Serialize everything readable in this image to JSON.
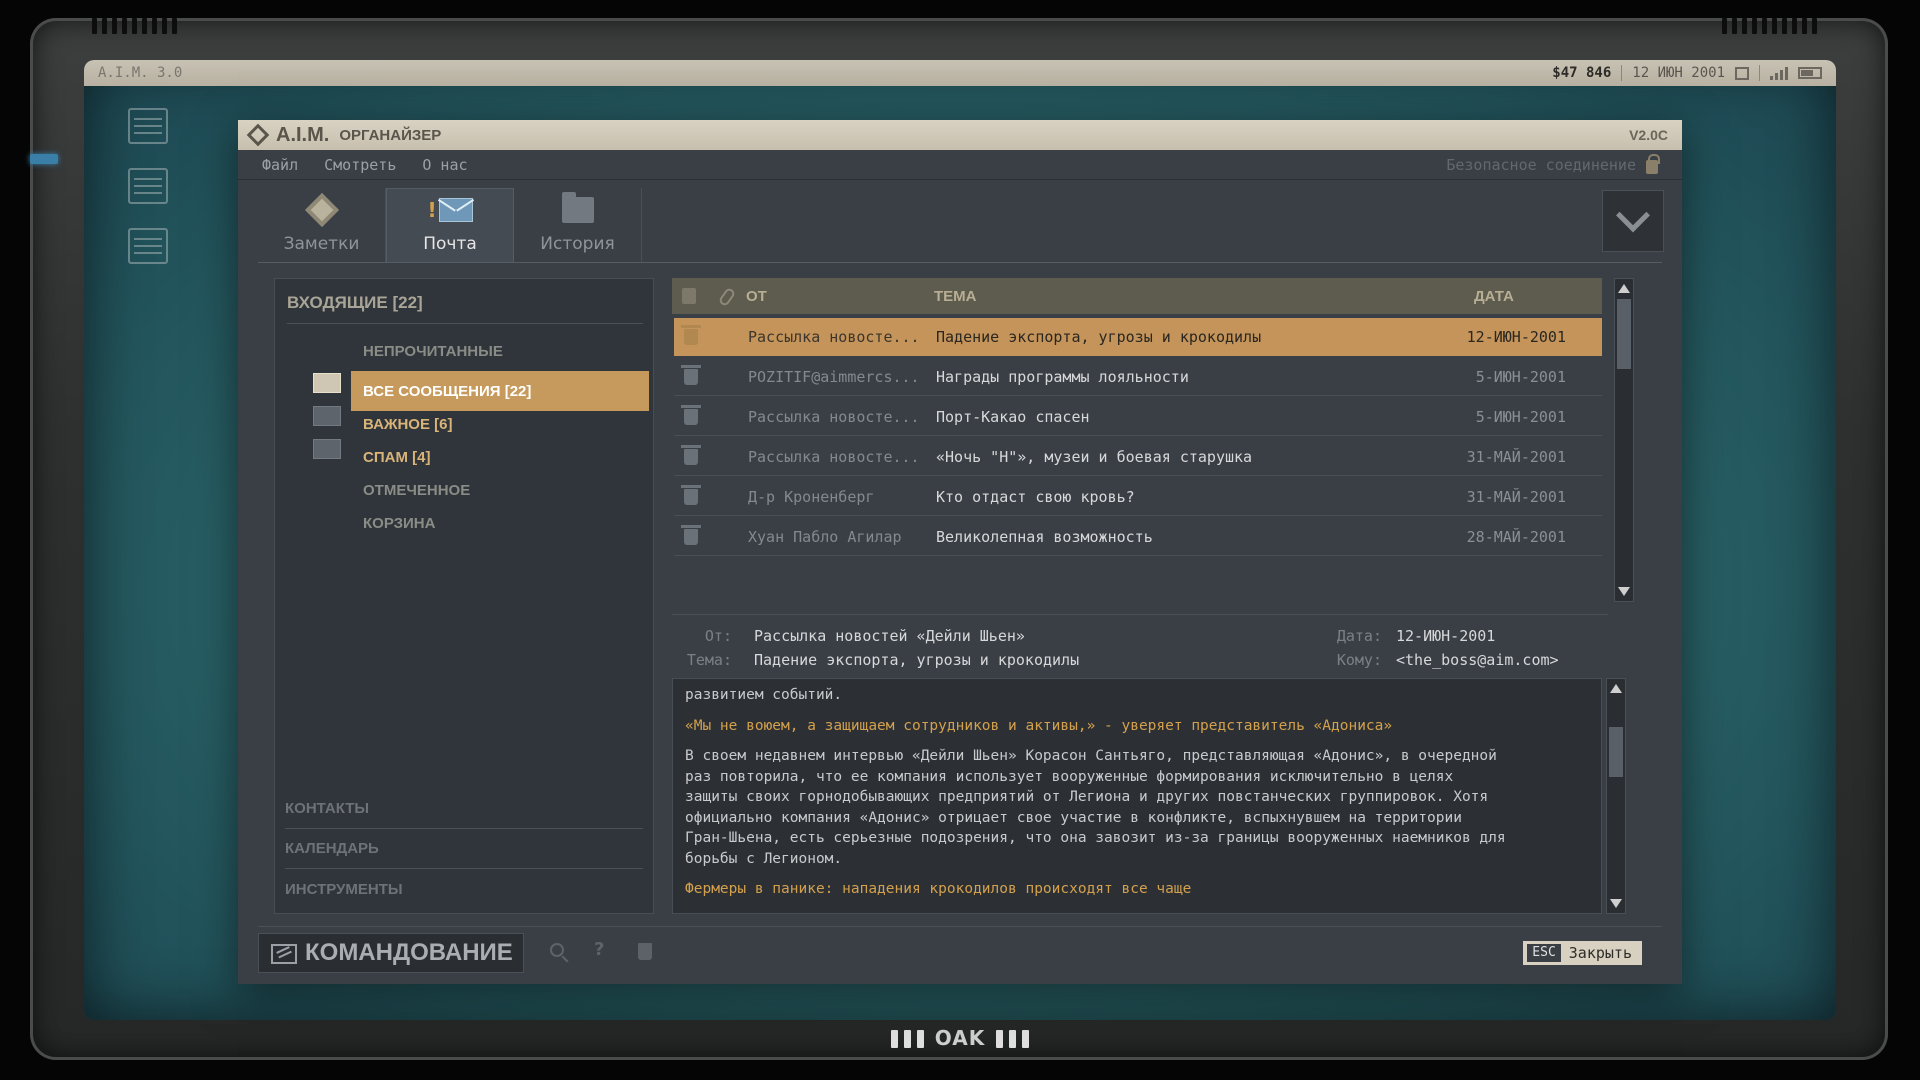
{
  "os": {
    "title": "A.I.M. 3.0",
    "balance": "$47 846",
    "date": "12 ИЮН 2001"
  },
  "window": {
    "title": "A.I.M.",
    "subtitle": "ОРГАНАЙЗЕР",
    "version": "V2.0C",
    "menu": [
      "Файл",
      "Смотреть",
      "О нас"
    ],
    "secure_text": "Безопасное соединение"
  },
  "tabs": [
    {
      "label": "Заметки",
      "icon": "diamond-icon"
    },
    {
      "label": "Почта",
      "icon": "mail-icon",
      "active": true,
      "badge": "!"
    },
    {
      "label": "История",
      "icon": "folder-icon"
    }
  ],
  "folders": {
    "inbox_title": "ВХОДЯЩИЕ [22]",
    "items": [
      {
        "label": "НЕПРОЧИТАННЫЕ"
      },
      {
        "label": "ВСЕ СООБЩЕНИЯ [22]",
        "active": true
      },
      {
        "label": "ВАЖНОЕ [6]"
      },
      {
        "label": "СПАМ [4]"
      },
      {
        "label": "ОТМЕЧЕННОЕ"
      },
      {
        "label": "КОРЗИНА"
      }
    ],
    "sections": [
      "КОНТАКТЫ",
      "КАЛЕНДАРЬ",
      "ИНСТРУМЕНТЫ"
    ]
  },
  "list": {
    "headers": {
      "from": "ОТ",
      "subject": "ТЕМА",
      "date": "ДАТА"
    },
    "rows": [
      {
        "from": "Рассылка новосте...",
        "subject": "Падение экспорта, угрозы и крокодилы",
        "date": "12-ИЮН-2001",
        "selected": true
      },
      {
        "from": "POZITIF@aimmercs...",
        "subject": "Награды программы лояльности",
        "date": "5-ИЮН-2001"
      },
      {
        "from": "Рассылка новосте...",
        "subject": "Порт-Какао спасен",
        "date": "5-ИЮН-2001"
      },
      {
        "from": "Рассылка новосте...",
        "subject": "«Ночь \"Н\"», музеи и боевая старушка",
        "date": "31-МАЙ-2001"
      },
      {
        "from": "Д-р Кроненберг",
        "subject": "Кто отдаст свою кровь?",
        "date": "31-МАЙ-2001"
      },
      {
        "from": "Хуан Пабло Агилар",
        "subject": "Великолепная возможность",
        "date": "28-МАЙ-2001"
      }
    ]
  },
  "message": {
    "from_label": "От:",
    "from": "Рассылка новостей «Дейли Шьен»",
    "subject_label": "Тема:",
    "subject": "Падение экспорта, угрозы и крокодилы",
    "date_label": "Дата:",
    "date": "12-ИЮН-2001",
    "to_label": "Кому:",
    "to": "<the_boss@aim.com>",
    "body": {
      "line1": "развитием событий.",
      "quote": "«Мы не воюем, а защищаем сотрудников и активы,» - уверяет представитель «Адониса»",
      "para_lines": [
        "В своем недавнем интервью «Дейли Шьен» Корасон Сантьяго, представляющая «Адонис», в очередной",
        "раз повторила, что ее компания использует вооруженные формирования исключительно в целях",
        "защиты своих горнодобывающих предприятий от Легиона и других повстанческих группировок. Хотя",
        "официально компания «Адонис» отрицает свое участие в конфликте, вспыхнувшем на территории",
        "Гран-Шьена, есть серьезные подозрения, что она завозит из-за границы вооруженных наемников для",
        "борьбы с Легионом."
      ],
      "headline2": "Фермеры в панике: нападения крокодилов происходят все чаще"
    }
  },
  "bottom": {
    "command_label": "КОМАНДОВАНИЕ",
    "esc_key": "ESC",
    "close_label": "Закрыть"
  },
  "brand": "OAK"
}
